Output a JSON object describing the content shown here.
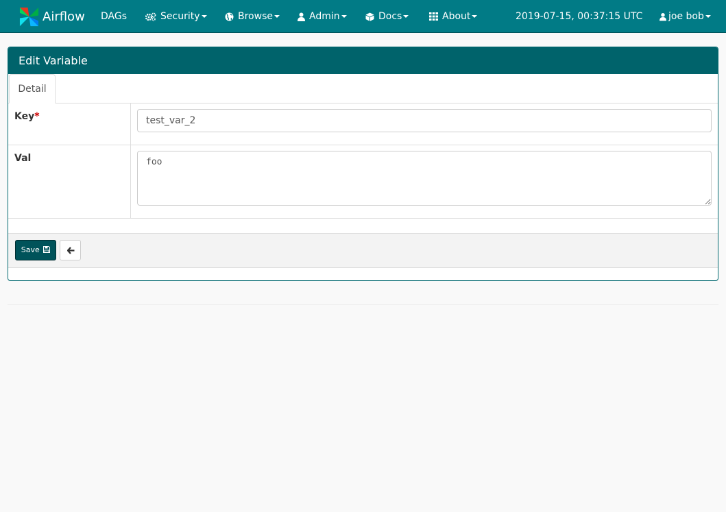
{
  "app": {
    "name": "Airflow"
  },
  "nav": {
    "dags": "DAGs",
    "security": "Security",
    "browse": "Browse",
    "admin": "Admin",
    "docs": "Docs",
    "about": "About",
    "datetime": "2019-07-15, 00:37:15 UTC",
    "user": "joe bob"
  },
  "panel": {
    "title": "Edit Variable",
    "tab": "Detail",
    "key_label": "Key",
    "required_mark": "*",
    "key_value": "test_var_2",
    "val_label": "Val",
    "val_value": "foo",
    "save_label": "Save"
  },
  "icons": {
    "security": "cogs-icon",
    "browse": "globe-icon",
    "admin": "user-icon",
    "docs": "cube-icon",
    "about": "grid-icon",
    "user": "user-icon",
    "save": "floppy-disk-icon",
    "back": "arrow-left-icon"
  },
  "colors": {
    "navbar": "#017b86",
    "panel_heading": "#00636b",
    "save_button": "#00535a"
  }
}
